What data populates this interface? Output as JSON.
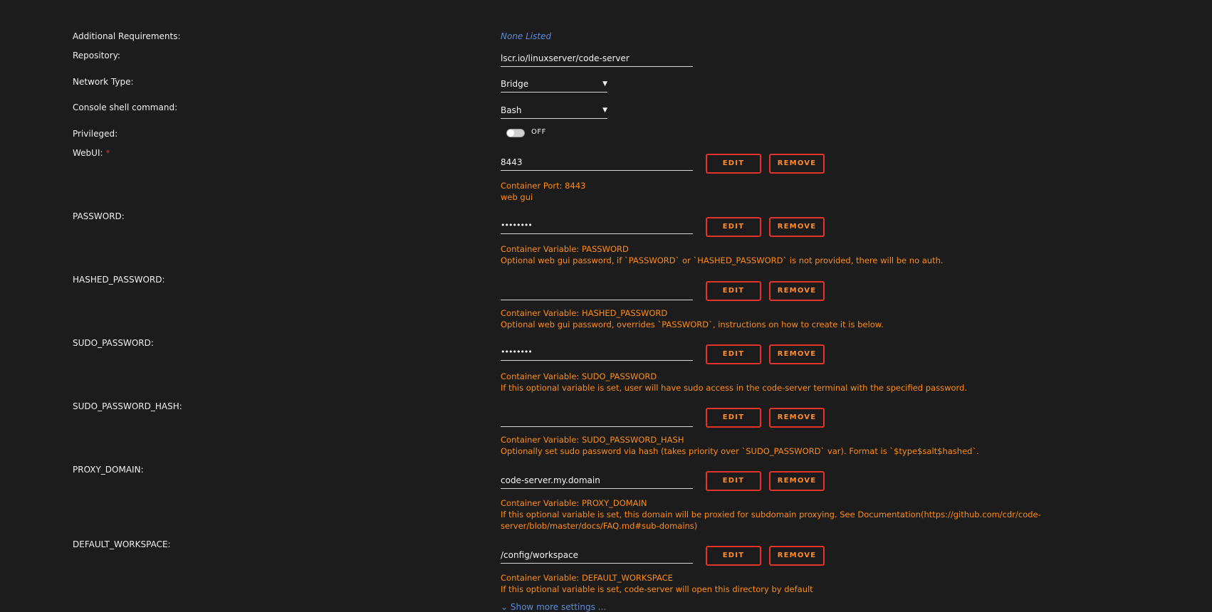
{
  "additional_requirements": {
    "label": "Additional Requirements:",
    "value": "None Listed"
  },
  "repository": {
    "label": "Repository:",
    "value": "lscr.io/linuxserver/code-server"
  },
  "network_type": {
    "label": "Network Type:",
    "value": "Bridge"
  },
  "console_shell": {
    "label": "Console shell command:",
    "value": "Bash"
  },
  "privileged": {
    "label": "Privileged:",
    "state": "OFF"
  },
  "buttons": {
    "edit": "EDIT",
    "remove": "REMOVE"
  },
  "config_items": [
    {
      "label": "WebUI:",
      "required": "*",
      "value": "8443",
      "desc_line1": "Container Port: 8443",
      "desc_line2": "web gui"
    },
    {
      "label": "PASSWORD:",
      "value": "••••••••",
      "desc_line1": "Container Variable: PASSWORD",
      "desc_line2": "Optional web gui password, if `PASSWORD` or `HASHED_PASSWORD` is not provided, there will be no auth."
    },
    {
      "label": "HASHED_PASSWORD:",
      "value": "",
      "desc_line1": "Container Variable: HASHED_PASSWORD",
      "desc_line2": "Optional web gui password, overrides `PASSWORD`, instructions on how to create it is below."
    },
    {
      "label": "SUDO_PASSWORD:",
      "value": "••••••••",
      "desc_line1": "Container Variable: SUDO_PASSWORD",
      "desc_line2": "If this optional variable is set, user will have sudo access in the code-server terminal with the specified password."
    },
    {
      "label": "SUDO_PASSWORD_HASH:",
      "value": "",
      "desc_line1": "Container Variable: SUDO_PASSWORD_HASH",
      "desc_line2": "Optionally set sudo password via hash (takes priority over `SUDO_PASSWORD` var). Format is `$type$salt$hashed`."
    },
    {
      "label": "PROXY_DOMAIN:",
      "value": "code-server.my.domain",
      "desc_line1": "Container Variable: PROXY_DOMAIN",
      "desc_line2": "If this optional variable is set, this domain will be proxied for subdomain proxying. See Documentation(https://github.com/cdr/code-server/blob/master/docs/FAQ.md#sub-domains)"
    },
    {
      "label": "DEFAULT_WORKSPACE:",
      "value": "/config/workspace",
      "desc_line1": "Container Variable: DEFAULT_WORKSPACE",
      "desc_line2": "If this optional variable is set, code-server will open this directory by default"
    }
  ],
  "show_more": "⌄ Show more settings ..."
}
